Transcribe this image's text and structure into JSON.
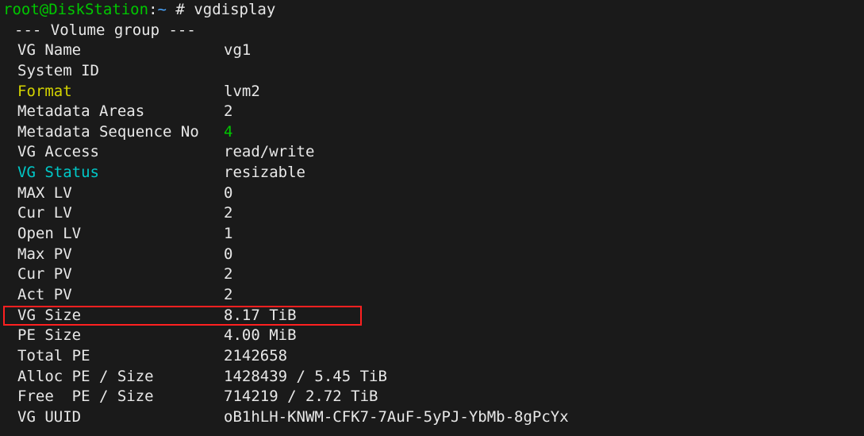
{
  "prompt": {
    "user": "root",
    "host": "DiskStation",
    "path": "~",
    "symbol": "#",
    "command": "vgdisplay"
  },
  "header": "--- Volume group ---",
  "rows": [
    {
      "label": "VG Name",
      "value": "vg1",
      "labelClass": "",
      "valueClass": ""
    },
    {
      "label": "System ID",
      "value": "",
      "labelClass": "",
      "valueClass": ""
    },
    {
      "label": "Format",
      "value": "lvm2",
      "labelClass": "yellow",
      "valueClass": ""
    },
    {
      "label": "Metadata Areas",
      "value": "2",
      "labelClass": "",
      "valueClass": ""
    },
    {
      "label": "Metadata Sequence No",
      "value": "4",
      "labelClass": "",
      "valueClass": "green"
    },
    {
      "label": "VG Access",
      "value": "read/write",
      "labelClass": "",
      "valueClass": ""
    },
    {
      "label": "VG Status",
      "value": "resizable",
      "labelClass": "teal",
      "valueClass": ""
    },
    {
      "label": "MAX LV",
      "value": "0",
      "labelClass": "",
      "valueClass": ""
    },
    {
      "label": "Cur LV",
      "value": "2",
      "labelClass": "",
      "valueClass": ""
    },
    {
      "label": "Open LV",
      "value": "1",
      "labelClass": "",
      "valueClass": ""
    },
    {
      "label": "Max PV",
      "value": "0",
      "labelClass": "",
      "valueClass": ""
    },
    {
      "label": "Cur PV",
      "value": "2",
      "labelClass": "",
      "valueClass": ""
    },
    {
      "label": "Act PV",
      "value": "2",
      "labelClass": "",
      "valueClass": ""
    },
    {
      "label": "VG Size",
      "value": "8.17 TiB",
      "labelClass": "",
      "valueClass": "",
      "highlighted": true
    },
    {
      "label": "PE Size",
      "value": "4.00 MiB",
      "labelClass": "",
      "valueClass": ""
    },
    {
      "label": "Total PE",
      "value": "2142658",
      "labelClass": "",
      "valueClass": ""
    },
    {
      "label": "Alloc PE / Size",
      "value": "1428439 / 5.45 TiB",
      "labelClass": "",
      "valueClass": ""
    },
    {
      "label": "Free  PE / Size",
      "value": "714219 / 2.72 TiB",
      "labelClass": "",
      "valueClass": ""
    },
    {
      "label": "VG UUID",
      "value": "oB1hLH-KNWM-CFK7-7AuF-5yPJ-YbMb-8gPcYx",
      "labelClass": "",
      "valueClass": ""
    }
  ]
}
